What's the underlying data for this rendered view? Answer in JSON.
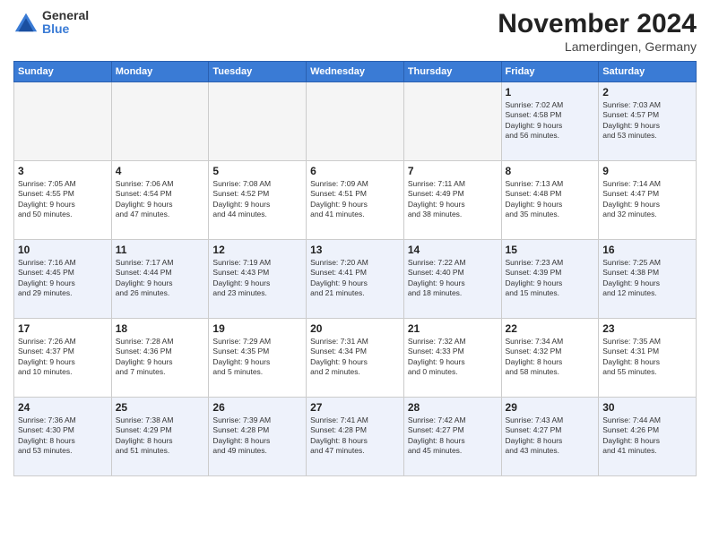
{
  "header": {
    "logo_general": "General",
    "logo_blue": "Blue",
    "month_title": "November 2024",
    "location": "Lamerdingen, Germany"
  },
  "weekdays": [
    "Sunday",
    "Monday",
    "Tuesday",
    "Wednesday",
    "Thursday",
    "Friday",
    "Saturday"
  ],
  "weeks": [
    [
      {
        "day": "",
        "info": ""
      },
      {
        "day": "",
        "info": ""
      },
      {
        "day": "",
        "info": ""
      },
      {
        "day": "",
        "info": ""
      },
      {
        "day": "",
        "info": ""
      },
      {
        "day": "1",
        "info": "Sunrise: 7:02 AM\nSunset: 4:58 PM\nDaylight: 9 hours\nand 56 minutes."
      },
      {
        "day": "2",
        "info": "Sunrise: 7:03 AM\nSunset: 4:57 PM\nDaylight: 9 hours\nand 53 minutes."
      }
    ],
    [
      {
        "day": "3",
        "info": "Sunrise: 7:05 AM\nSunset: 4:55 PM\nDaylight: 9 hours\nand 50 minutes."
      },
      {
        "day": "4",
        "info": "Sunrise: 7:06 AM\nSunset: 4:54 PM\nDaylight: 9 hours\nand 47 minutes."
      },
      {
        "day": "5",
        "info": "Sunrise: 7:08 AM\nSunset: 4:52 PM\nDaylight: 9 hours\nand 44 minutes."
      },
      {
        "day": "6",
        "info": "Sunrise: 7:09 AM\nSunset: 4:51 PM\nDaylight: 9 hours\nand 41 minutes."
      },
      {
        "day": "7",
        "info": "Sunrise: 7:11 AM\nSunset: 4:49 PM\nDaylight: 9 hours\nand 38 minutes."
      },
      {
        "day": "8",
        "info": "Sunrise: 7:13 AM\nSunset: 4:48 PM\nDaylight: 9 hours\nand 35 minutes."
      },
      {
        "day": "9",
        "info": "Sunrise: 7:14 AM\nSunset: 4:47 PM\nDaylight: 9 hours\nand 32 minutes."
      }
    ],
    [
      {
        "day": "10",
        "info": "Sunrise: 7:16 AM\nSunset: 4:45 PM\nDaylight: 9 hours\nand 29 minutes."
      },
      {
        "day": "11",
        "info": "Sunrise: 7:17 AM\nSunset: 4:44 PM\nDaylight: 9 hours\nand 26 minutes."
      },
      {
        "day": "12",
        "info": "Sunrise: 7:19 AM\nSunset: 4:43 PM\nDaylight: 9 hours\nand 23 minutes."
      },
      {
        "day": "13",
        "info": "Sunrise: 7:20 AM\nSunset: 4:41 PM\nDaylight: 9 hours\nand 21 minutes."
      },
      {
        "day": "14",
        "info": "Sunrise: 7:22 AM\nSunset: 4:40 PM\nDaylight: 9 hours\nand 18 minutes."
      },
      {
        "day": "15",
        "info": "Sunrise: 7:23 AM\nSunset: 4:39 PM\nDaylight: 9 hours\nand 15 minutes."
      },
      {
        "day": "16",
        "info": "Sunrise: 7:25 AM\nSunset: 4:38 PM\nDaylight: 9 hours\nand 12 minutes."
      }
    ],
    [
      {
        "day": "17",
        "info": "Sunrise: 7:26 AM\nSunset: 4:37 PM\nDaylight: 9 hours\nand 10 minutes."
      },
      {
        "day": "18",
        "info": "Sunrise: 7:28 AM\nSunset: 4:36 PM\nDaylight: 9 hours\nand 7 minutes."
      },
      {
        "day": "19",
        "info": "Sunrise: 7:29 AM\nSunset: 4:35 PM\nDaylight: 9 hours\nand 5 minutes."
      },
      {
        "day": "20",
        "info": "Sunrise: 7:31 AM\nSunset: 4:34 PM\nDaylight: 9 hours\nand 2 minutes."
      },
      {
        "day": "21",
        "info": "Sunrise: 7:32 AM\nSunset: 4:33 PM\nDaylight: 9 hours\nand 0 minutes."
      },
      {
        "day": "22",
        "info": "Sunrise: 7:34 AM\nSunset: 4:32 PM\nDaylight: 8 hours\nand 58 minutes."
      },
      {
        "day": "23",
        "info": "Sunrise: 7:35 AM\nSunset: 4:31 PM\nDaylight: 8 hours\nand 55 minutes."
      }
    ],
    [
      {
        "day": "24",
        "info": "Sunrise: 7:36 AM\nSunset: 4:30 PM\nDaylight: 8 hours\nand 53 minutes."
      },
      {
        "day": "25",
        "info": "Sunrise: 7:38 AM\nSunset: 4:29 PM\nDaylight: 8 hours\nand 51 minutes."
      },
      {
        "day": "26",
        "info": "Sunrise: 7:39 AM\nSunset: 4:28 PM\nDaylight: 8 hours\nand 49 minutes."
      },
      {
        "day": "27",
        "info": "Sunrise: 7:41 AM\nSunset: 4:28 PM\nDaylight: 8 hours\nand 47 minutes."
      },
      {
        "day": "28",
        "info": "Sunrise: 7:42 AM\nSunset: 4:27 PM\nDaylight: 8 hours\nand 45 minutes."
      },
      {
        "day": "29",
        "info": "Sunrise: 7:43 AM\nSunset: 4:27 PM\nDaylight: 8 hours\nand 43 minutes."
      },
      {
        "day": "30",
        "info": "Sunrise: 7:44 AM\nSunset: 4:26 PM\nDaylight: 8 hours\nand 41 minutes."
      }
    ]
  ]
}
